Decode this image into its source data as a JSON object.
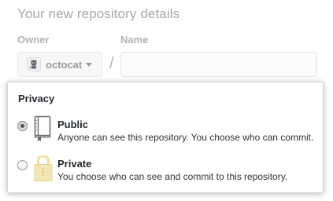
{
  "header": {
    "title": "Your new repository details"
  },
  "owner": {
    "label": "Owner",
    "value": "octocat",
    "avatar_icon": "octocat-avatar-icon",
    "dropdown_icon": "caret-down-icon"
  },
  "separator": "/",
  "name": {
    "label": "Name",
    "value": "",
    "placeholder": ""
  },
  "privacy": {
    "title": "Privacy",
    "options": [
      {
        "title": "Public",
        "description": "Anyone can see this repository. You choose who can commit.",
        "icon": "repo-book-icon",
        "checked": true
      },
      {
        "title": "Private",
        "description": "You choose who can see and commit to this repository.",
        "icon": "lock-icon",
        "checked": false
      }
    ]
  },
  "colors": {
    "lock": "#f0e0a6",
    "muted_text": "#a8a8a8"
  }
}
